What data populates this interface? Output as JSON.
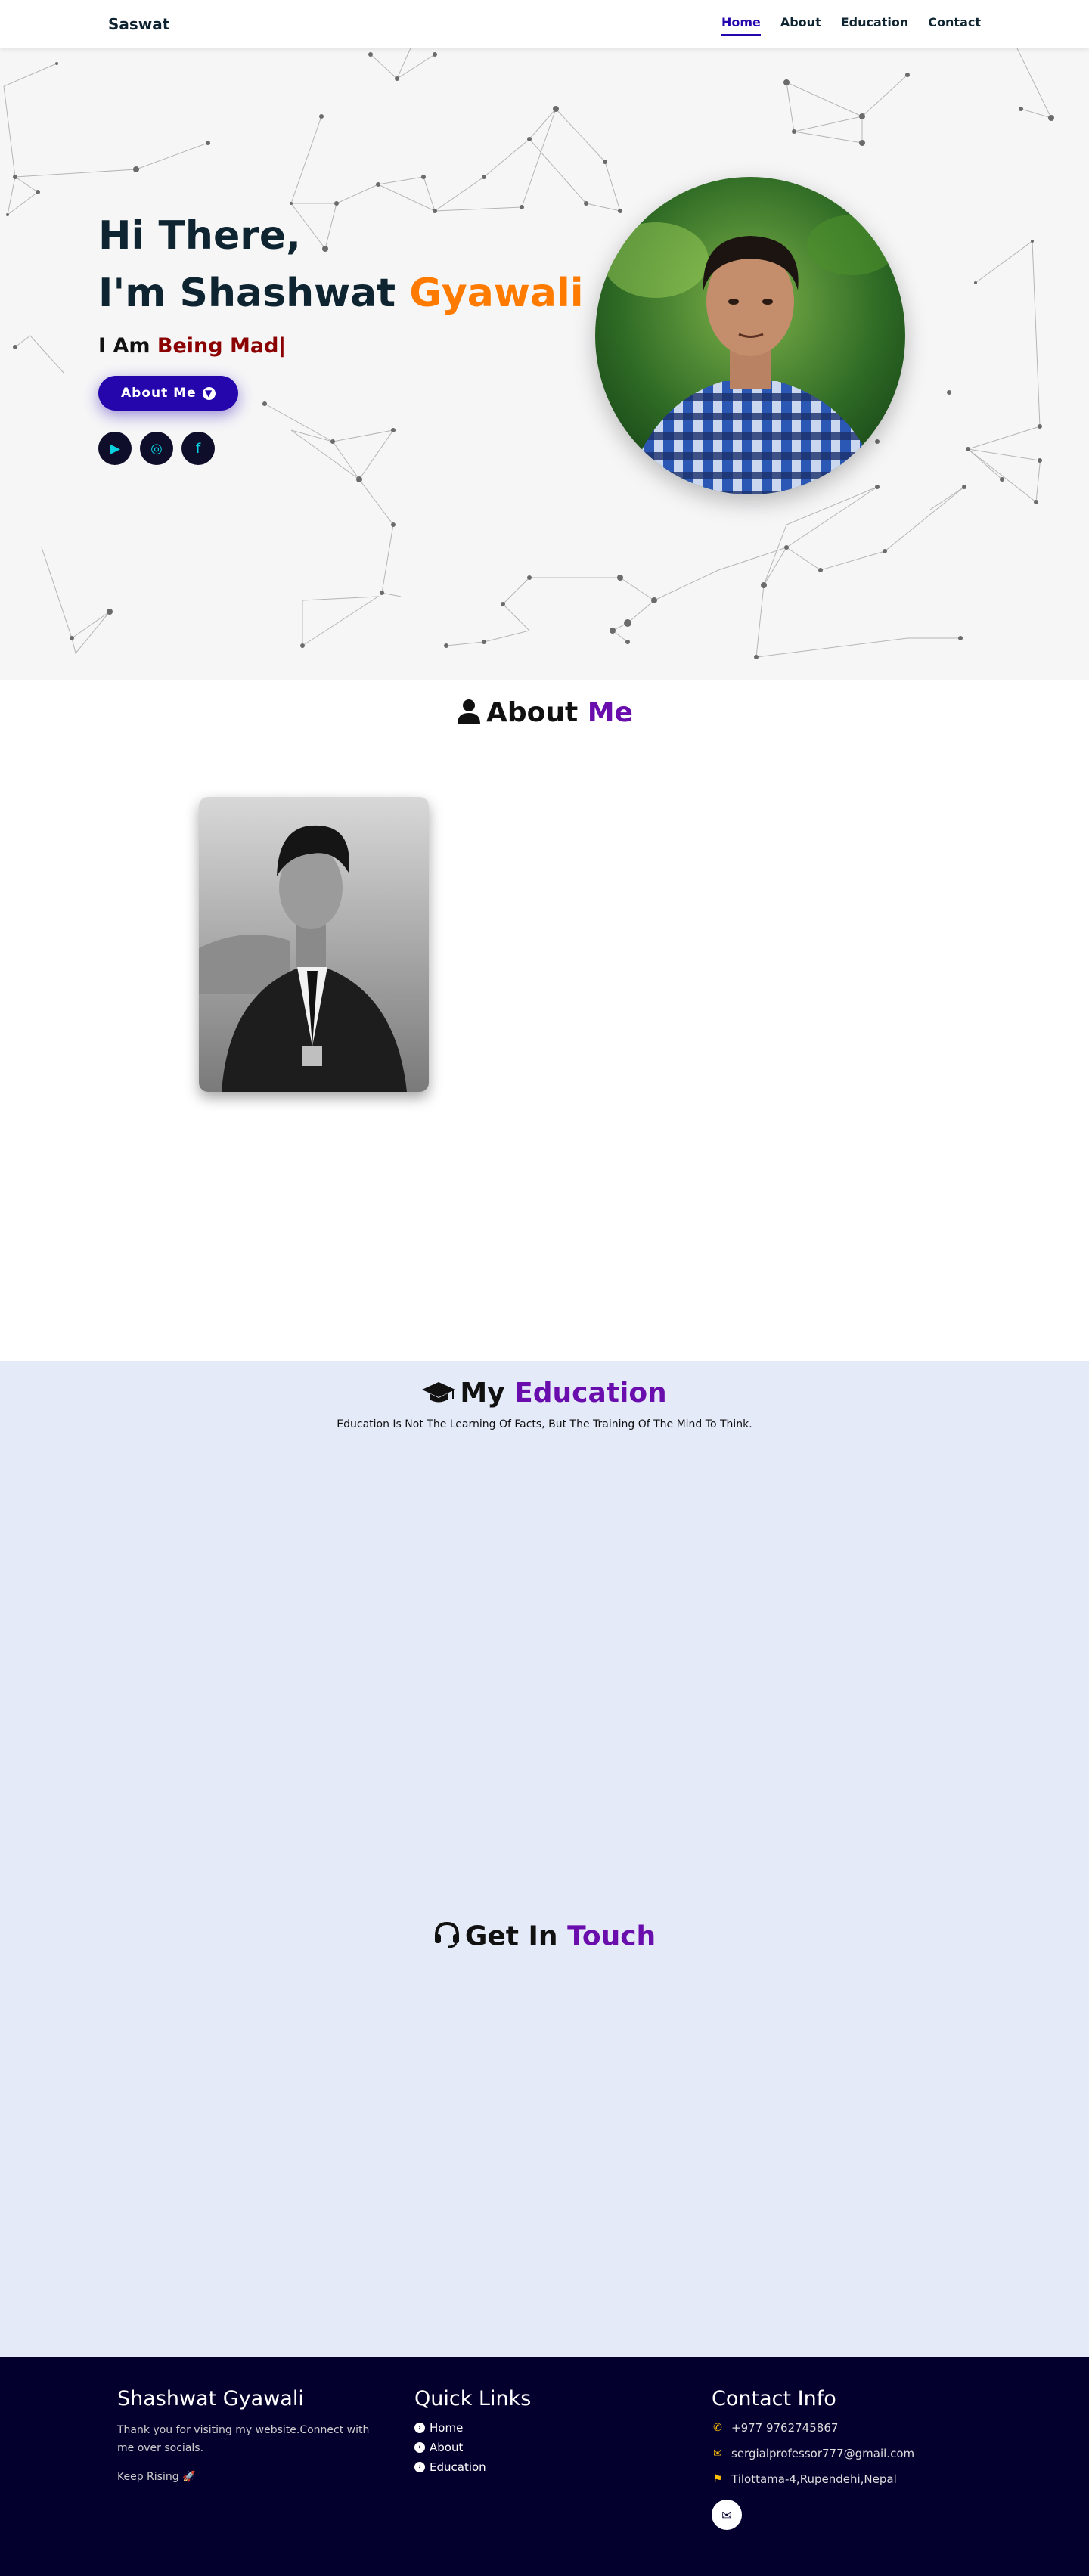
{
  "nav": {
    "brand": "Saswat",
    "links": [
      {
        "label": "Home"
      },
      {
        "label": "About"
      },
      {
        "label": "Education"
      },
      {
        "label": "Contact"
      }
    ]
  },
  "hero": {
    "greeting": "Hi There,",
    "name_prefix": "I'm Shashwat ",
    "name_accent": "Gyawali",
    "typing_prefix": "I Am ",
    "typing_text": "Being Mad|",
    "button_label": "About Me",
    "socials": [
      {
        "icon": "youtube-icon",
        "glyph": "▶"
      },
      {
        "icon": "instagram-icon",
        "glyph": "◎"
      },
      {
        "icon": "facebook-icon",
        "glyph": "f"
      }
    ]
  },
  "about": {
    "heading_prefix": "About ",
    "heading_accent": "Me"
  },
  "education": {
    "heading_prefix": "My ",
    "heading_accent": "Education",
    "quote": "Education Is Not The Learning Of Facts, But The Training Of The Mind To Think."
  },
  "contact": {
    "heading_prefix": "Get In ",
    "heading_accent": "Touch"
  },
  "footer": {
    "col1": {
      "title": "Shashwat Gyawali",
      "text": "Thank you for visiting my website.Connect with me over socials.",
      "tagline": "Keep Rising 🚀"
    },
    "col2": {
      "title": "Quick Links",
      "links": [
        "Home",
        "About",
        "Education"
      ]
    },
    "col3": {
      "title": "Contact Info",
      "phone": "+977 9762745867",
      "email": "sergialprofessor777@gmail.com",
      "address": "Tilottama-4,Rupendehi,Nepal"
    }
  },
  "colors": {
    "primary": "#2506ad",
    "accent_orange": "#ff7b00",
    "accent_purple": "#6a0dad",
    "footer_bg": "#03002e",
    "section_bg": "#e5eaf9"
  }
}
